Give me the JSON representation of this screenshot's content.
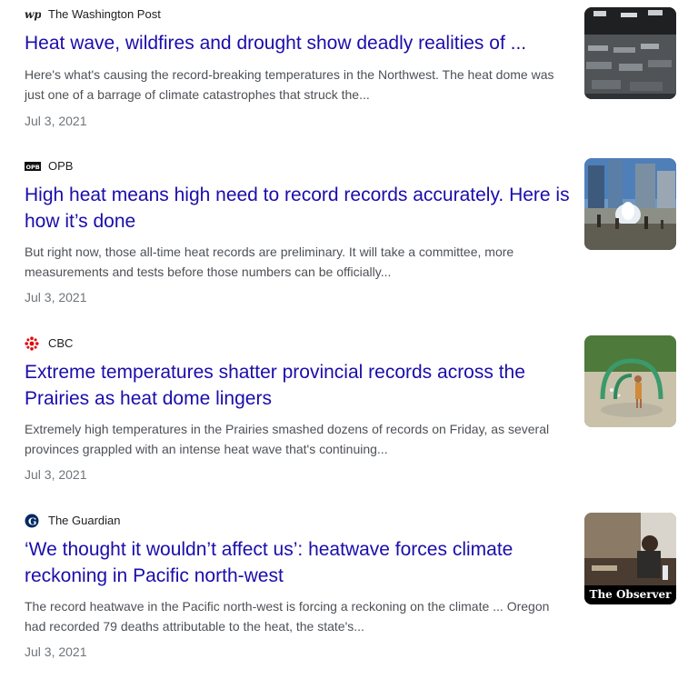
{
  "articles": [
    {
      "source": "The Washington Post",
      "logo": "washington-post-logo",
      "headline": "Heat wave, wildfires and drought show deadly realities of ...",
      "snippet": "Here's what's causing the record-breaking temperatures in the Northwest. The heat dome was just one of a barrage of climate catastrophes that struck the...",
      "date": "Jul 3, 2021",
      "thumbnail": "cooling-center-photo"
    },
    {
      "source": "OPB",
      "logo": "opb-logo",
      "headline": "High heat means high need to record records accurately. Here is how it’s done",
      "snippet": "But right now, those all-time heat records are preliminary. It will take a committee, more measurements and tests before those numbers can be officially...",
      "date": "Jul 3, 2021",
      "thumbnail": "city-fountain-photo"
    },
    {
      "source": "CBC",
      "logo": "cbc-logo",
      "headline": "Extreme temperatures shatter provincial records across the Prairies as heat dome lingers",
      "snippet": "Extremely high temperatures in the Prairies smashed dozens of records on Friday, as several provinces grappled with an intense heat wave that's continuing...",
      "date": "Jul 3, 2021",
      "thumbnail": "splash-pad-photo"
    },
    {
      "source": "The Guardian",
      "logo": "guardian-logo",
      "headline": "‘We thought it wouldn’t affect us’: heatwave forces climate reckoning in Pacific north-west",
      "snippet": "The record heatwave in the Pacific north-west is forcing a reckoning on the climate ... Oregon had recorded 79 deaths attributable to the heat, the state's...",
      "date": "Jul 3, 2021",
      "thumbnail": "observer-photo",
      "thumbnail_caption": "The Observer"
    }
  ],
  "colors": {
    "headline": "#1a0dab",
    "snippet": "#4d5156",
    "date": "#70757a",
    "source": "#202124",
    "cbc_red": "#e60505",
    "guardian_blue": "#052962"
  }
}
